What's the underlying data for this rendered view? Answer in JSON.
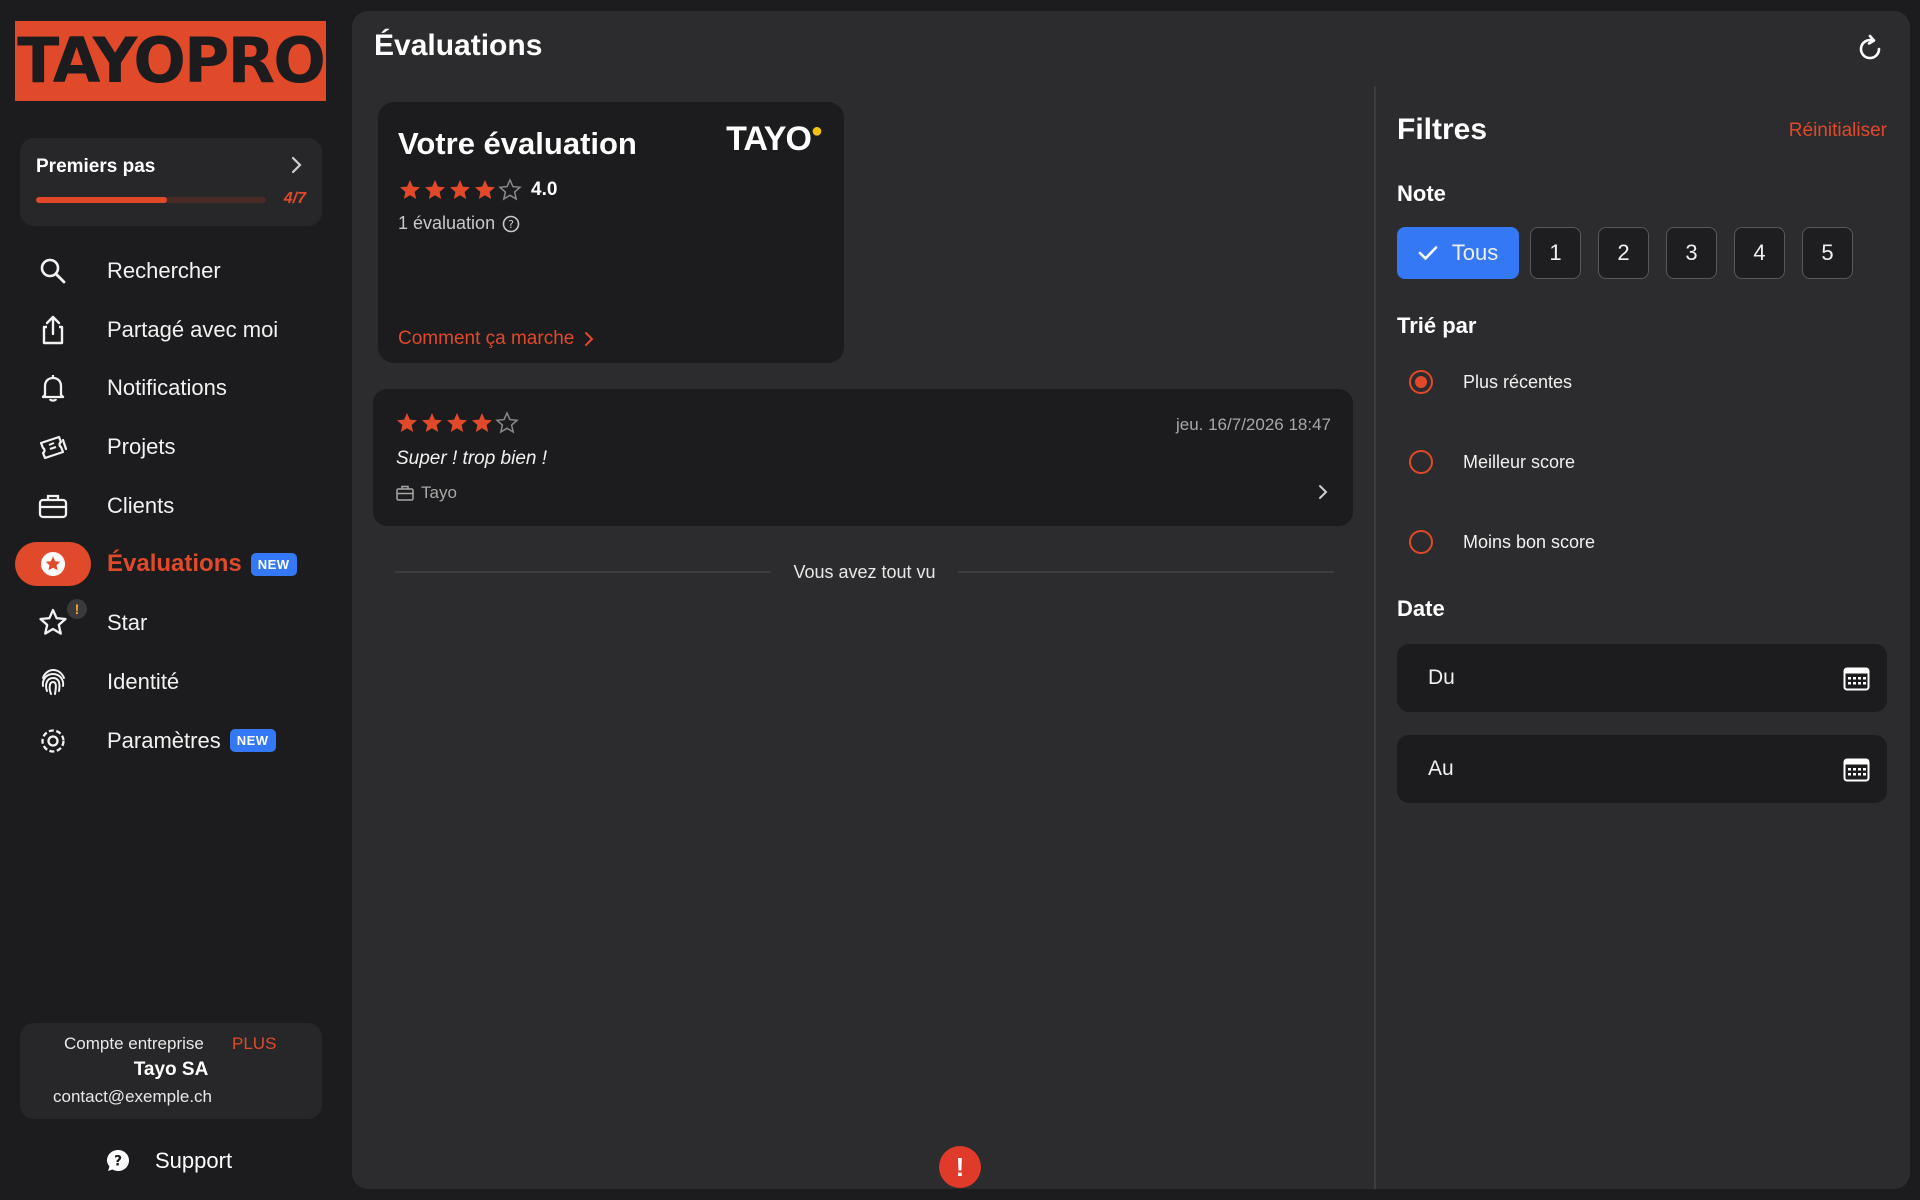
{
  "brand": {
    "logo_text": "TAYOPRO",
    "accent": "#e04a2a"
  },
  "onboarding": {
    "title": "Premiers pas",
    "progress_text": "4/7",
    "progress_fraction": 0.571
  },
  "nav": {
    "items": [
      {
        "label": "Rechercher",
        "icon": "search-icon"
      },
      {
        "label": "Partagé avec moi",
        "icon": "share-icon"
      },
      {
        "label": "Notifications",
        "icon": "bell-icon"
      },
      {
        "label": "Projets",
        "icon": "tickets-icon"
      },
      {
        "label": "Clients",
        "icon": "briefcase-icon"
      },
      {
        "label": "Évaluations",
        "icon": "star-badge-icon",
        "active": true,
        "badge": "NEW"
      },
      {
        "label": "Star",
        "icon": "star-outline-icon",
        "alert": "!"
      },
      {
        "label": "Identité",
        "icon": "fingerprint-icon"
      },
      {
        "label": "Paramètres",
        "icon": "gear-icon",
        "badge": "NEW"
      }
    ]
  },
  "account": {
    "type_label": "Compte entreprise",
    "plan": "PLUS",
    "name": "Tayo SA",
    "email": "contact@exemple.ch"
  },
  "support": {
    "label": "Support"
  },
  "main": {
    "title": "Évaluations",
    "score_card": {
      "title": "Votre évaluation",
      "brand": "TAYO",
      "rating": "4.0",
      "stars": 4,
      "count_text": "1 évaluation",
      "link_text": "Comment ça marche"
    },
    "reviews": [
      {
        "stars": 4,
        "date": "jeu. 16/7/2026 18:47",
        "text": "Super ! trop bien !",
        "client": "Tayo"
      }
    ],
    "end_text": "Vous avez tout vu",
    "alert_symbol": "!"
  },
  "filters": {
    "title": "Filtres",
    "reset": "Réinitialiser",
    "note_label": "Note",
    "note_options": [
      "Tous",
      "1",
      "2",
      "3",
      "4",
      "5"
    ],
    "note_selected": "Tous",
    "sort_label": "Trié par",
    "sort_options": [
      "Plus récentes",
      "Meilleur score",
      "Moins bon score"
    ],
    "sort_selected": "Plus récentes",
    "date_label": "Date",
    "date_from": "Du",
    "date_to": "Au"
  }
}
